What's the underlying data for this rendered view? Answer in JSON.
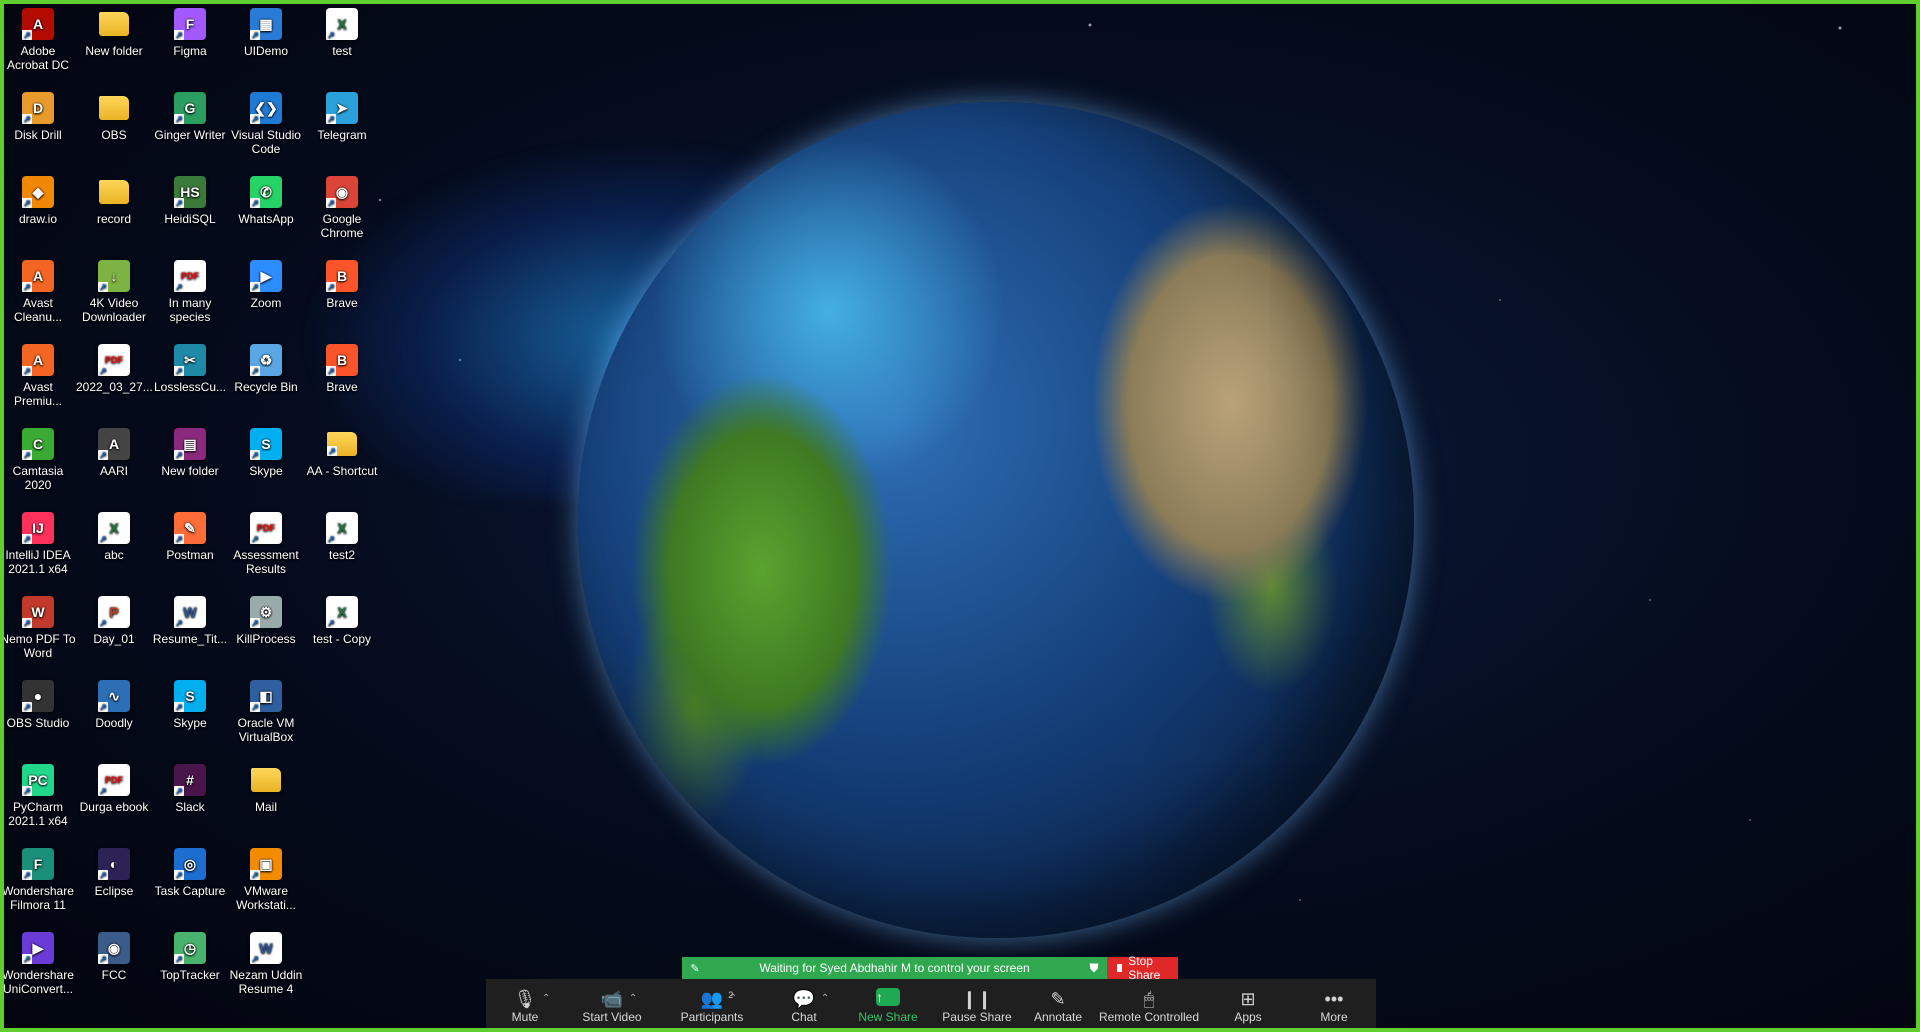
{
  "desktop": {
    "icons": [
      {
        "label": "Adobe Acrobat DC",
        "icon": "acrobat-icon",
        "color": "#b30b00",
        "glyph": "A",
        "kind": "app",
        "col": 0,
        "row": 0
      },
      {
        "label": "New folder",
        "icon": "folder-icon",
        "kind": "folder",
        "col": 1,
        "row": 0
      },
      {
        "label": "Figma",
        "icon": "figma-icon",
        "color": "#a259ff",
        "glyph": "F",
        "kind": "app",
        "col": 2,
        "row": 0
      },
      {
        "label": "UIDemo",
        "icon": "window-icon",
        "color": "#2a7ad8",
        "glyph": "▦",
        "kind": "app",
        "col": 3,
        "row": 0
      },
      {
        "label": "test",
        "icon": "excel-icon",
        "kind": "xls",
        "glyph": "X",
        "col": 4,
        "row": 0
      },
      {
        "label": "Disk Drill",
        "icon": "disk-drill-icon",
        "color": "#e79b2a",
        "glyph": "D",
        "kind": "app",
        "col": 0,
        "row": 1
      },
      {
        "label": "OBS",
        "icon": "folder-icon",
        "kind": "folder",
        "col": 1,
        "row": 1
      },
      {
        "label": "Ginger Writer",
        "icon": "ginger-icon",
        "color": "#2b9d5e",
        "glyph": "G",
        "kind": "app",
        "col": 2,
        "row": 1
      },
      {
        "label": "Visual Studio Code",
        "icon": "vscode-icon",
        "color": "#1f7ad4",
        "glyph": "❮❯",
        "kind": "app",
        "col": 3,
        "row": 1
      },
      {
        "label": "Telegram",
        "icon": "telegram-icon",
        "color": "#2aa1da",
        "glyph": "➤",
        "kind": "app",
        "col": 4,
        "row": 1
      },
      {
        "label": "draw.io",
        "icon": "drawio-icon",
        "color": "#f08705",
        "glyph": "◆",
        "kind": "app",
        "col": 0,
        "row": 2
      },
      {
        "label": "record",
        "icon": "folder-icon",
        "kind": "folder",
        "col": 1,
        "row": 2
      },
      {
        "label": "HeidiSQL",
        "icon": "heidisql-icon",
        "color": "#3a7a3a",
        "glyph": "HS",
        "kind": "app",
        "col": 2,
        "row": 2
      },
      {
        "label": "WhatsApp",
        "icon": "whatsapp-icon",
        "color": "#25d366",
        "glyph": "✆",
        "kind": "app",
        "col": 3,
        "row": 2
      },
      {
        "label": "Google Chrome",
        "icon": "chrome-icon",
        "color": "#db4437",
        "glyph": "◉",
        "kind": "app",
        "col": 4,
        "row": 2
      },
      {
        "label": "Avast Cleanu...",
        "icon": "avast-cleanup-icon",
        "color": "#f26522",
        "glyph": "A",
        "kind": "app",
        "col": 0,
        "row": 3
      },
      {
        "label": "4K Video Downloader",
        "icon": "4k-downloader-icon",
        "color": "#7cb342",
        "glyph": "↓",
        "kind": "app",
        "col": 1,
        "row": 3
      },
      {
        "label": "In many species",
        "icon": "pdf-icon",
        "kind": "pdf",
        "glyph": "PDF",
        "col": 2,
        "row": 3
      },
      {
        "label": "Zoom",
        "icon": "zoom-icon",
        "color": "#2d8cff",
        "glyph": "▶",
        "kind": "app",
        "col": 3,
        "row": 3
      },
      {
        "label": "Brave",
        "icon": "brave-icon",
        "color": "#fb542b",
        "glyph": "B",
        "kind": "app",
        "col": 4,
        "row": 3
      },
      {
        "label": "Avast Premiu...",
        "icon": "avast-icon",
        "color": "#f26522",
        "glyph": "A",
        "kind": "app",
        "col": 0,
        "row": 4
      },
      {
        "label": "2022_03_27...",
        "icon": "pdf-icon",
        "kind": "pdf",
        "glyph": "PDF",
        "col": 1,
        "row": 4
      },
      {
        "label": "LosslessCu...",
        "icon": "lossless-cut-icon",
        "color": "#1e8aa8",
        "glyph": "✂",
        "kind": "app",
        "col": 2,
        "row": 4
      },
      {
        "label": "Recycle Bin",
        "icon": "recycle-bin-icon",
        "color": "#5aa7e6",
        "glyph": "♻",
        "kind": "app",
        "col": 3,
        "row": 4
      },
      {
        "label": "Brave",
        "icon": "brave-icon",
        "color": "#fb542b",
        "glyph": "B",
        "kind": "app",
        "col": 4,
        "row": 4
      },
      {
        "label": "Camtasia 2020",
        "icon": "camtasia-icon",
        "color": "#3aaa35",
        "glyph": "C",
        "kind": "app",
        "col": 0,
        "row": 5
      },
      {
        "label": "AARI",
        "icon": "aari-icon",
        "color": "#444",
        "glyph": "A",
        "kind": "app",
        "col": 1,
        "row": 5
      },
      {
        "label": "New folder",
        "icon": "winrar-icon",
        "color": "#8b2a7c",
        "glyph": "▤",
        "kind": "app",
        "col": 2,
        "row": 5
      },
      {
        "label": "Skype",
        "icon": "skype-icon",
        "color": "#00aff0",
        "glyph": "S",
        "kind": "app",
        "col": 3,
        "row": 5
      },
      {
        "label": "AA - Shortcut",
        "icon": "folder-icon",
        "kind": "folder",
        "col": 4,
        "row": 5
      },
      {
        "label": "IntelliJ IDEA 2021.1 x64",
        "icon": "intellij-icon",
        "color": "#fe315d",
        "glyph": "IJ",
        "kind": "app",
        "col": 0,
        "row": 6
      },
      {
        "label": "abc",
        "icon": "excel-icon",
        "kind": "xls",
        "glyph": "X",
        "col": 1,
        "row": 6
      },
      {
        "label": "Postman",
        "icon": "postman-icon",
        "color": "#ff6c37",
        "glyph": "✎",
        "kind": "app",
        "col": 2,
        "row": 6
      },
      {
        "label": "Assessment Results",
        "icon": "pdf-icon",
        "kind": "pdf",
        "glyph": "PDF",
        "col": 3,
        "row": 6
      },
      {
        "label": "test2",
        "icon": "excel-icon",
        "kind": "xls",
        "glyph": "X",
        "col": 4,
        "row": 6
      },
      {
        "label": "Nemo PDF To Word",
        "icon": "nemo-pdf-icon",
        "color": "#c0392b",
        "glyph": "W",
        "kind": "app",
        "col": 0,
        "row": 7
      },
      {
        "label": "Day_01",
        "icon": "powerpoint-icon",
        "kind": "ppt",
        "glyph": "P",
        "col": 1,
        "row": 7
      },
      {
        "label": "Resume_Tit...",
        "icon": "word-icon",
        "kind": "doc",
        "glyph": "W",
        "col": 2,
        "row": 7
      },
      {
        "label": "KillProcess",
        "icon": "killprocess-icon",
        "color": "#9aa",
        "glyph": "⚙",
        "kind": "app",
        "col": 3,
        "row": 7
      },
      {
        "label": "test - Copy",
        "icon": "excel-icon",
        "kind": "xls",
        "glyph": "X",
        "col": 4,
        "row": 7
      },
      {
        "label": "OBS Studio",
        "icon": "obs-icon",
        "color": "#333",
        "glyph": "●",
        "kind": "app",
        "col": 0,
        "row": 8
      },
      {
        "label": "Doodly",
        "icon": "doodly-icon",
        "color": "#2c6fb7",
        "glyph": "∿",
        "kind": "app",
        "col": 1,
        "row": 8
      },
      {
        "label": "Skype",
        "icon": "skype-icon",
        "color": "#00aff0",
        "glyph": "S",
        "kind": "app",
        "col": 2,
        "row": 8
      },
      {
        "label": "Oracle VM VirtualBox",
        "icon": "virtualbox-icon",
        "color": "#2f5f9e",
        "glyph": "◧",
        "kind": "app",
        "col": 3,
        "row": 8
      },
      {
        "label": "PyCharm 2021.1 x64",
        "icon": "pycharm-icon",
        "color": "#21d789",
        "glyph": "PC",
        "kind": "app",
        "col": 0,
        "row": 9
      },
      {
        "label": "Durga ebook",
        "icon": "pdf-icon",
        "kind": "pdf",
        "glyph": "PDF",
        "col": 1,
        "row": 9
      },
      {
        "label": "Slack",
        "icon": "slack-icon",
        "color": "#4a154b",
        "glyph": "#",
        "kind": "app",
        "col": 2,
        "row": 9
      },
      {
        "label": "Mail",
        "icon": "folder-icon",
        "kind": "folder",
        "col": 3,
        "row": 9
      },
      {
        "label": "Wondershare Filmora 11",
        "icon": "filmora-icon",
        "color": "#1a8f7a",
        "glyph": "F",
        "kind": "app",
        "col": 0,
        "row": 10
      },
      {
        "label": "Eclipse",
        "icon": "eclipse-icon",
        "color": "#2c2255",
        "glyph": "◐",
        "kind": "app",
        "col": 1,
        "row": 10
      },
      {
        "label": "Task Capture",
        "icon": "task-capture-icon",
        "color": "#1c6fd1",
        "glyph": "◎",
        "kind": "app",
        "col": 2,
        "row": 10
      },
      {
        "label": "VMware Workstati...",
        "icon": "vmware-icon",
        "color": "#f38b00",
        "glyph": "▣",
        "kind": "app",
        "col": 3,
        "row": 10
      },
      {
        "label": "Wondershare UniConvert...",
        "icon": "uniconverter-icon",
        "color": "#6a3bd6",
        "glyph": "▶",
        "kind": "app",
        "col": 0,
        "row": 11
      },
      {
        "label": "FCC",
        "icon": "fcc-icon",
        "color": "#3b5b8a",
        "glyph": "◉",
        "kind": "app",
        "col": 1,
        "row": 11
      },
      {
        "label": "TopTracker",
        "icon": "toptracker-icon",
        "color": "#47b36c",
        "glyph": "◷",
        "kind": "app",
        "col": 2,
        "row": 11
      },
      {
        "label": "Nezam Uddin Resume 4",
        "icon": "word-icon",
        "kind": "doc",
        "glyph": "W",
        "col": 3,
        "row": 11
      }
    ]
  },
  "share_banner": {
    "message": "Waiting for Syed Abdhahir M to control your screen",
    "stop_label": "Stop Share",
    "color": "#2fa84f",
    "stop_color": "#e02828"
  },
  "toolbar": {
    "buttons": [
      {
        "name": "mute-button",
        "icon": "microphone-icon",
        "glyph": "🎙",
        "label": "Mute",
        "caret": true,
        "width": 78
      },
      {
        "name": "start-video-button",
        "icon": "video-off-icon",
        "glyph": "📹",
        "label": "Start Video",
        "caret": true,
        "width": 96
      },
      {
        "name": "participants-button",
        "icon": "participants-icon",
        "glyph": "👥",
        "label": "Participants",
        "caret": true,
        "badge": "2",
        "width": 104
      },
      {
        "name": "chat-button",
        "icon": "chat-icon",
        "glyph": "💬",
        "label": "Chat",
        "caret": true,
        "width": 80
      },
      {
        "name": "new-share-button",
        "icon": "share-up-icon",
        "glyph": "↑",
        "label": "New Share",
        "green": true,
        "width": 88
      },
      {
        "name": "pause-share-button",
        "icon": "pause-icon",
        "glyph": "❙❙",
        "label": "Pause Share",
        "width": 90
      },
      {
        "name": "annotate-button",
        "icon": "pen-icon",
        "glyph": "✎",
        "label": "Annotate",
        "width": 72
      },
      {
        "name": "remote-controlled-button",
        "icon": "mouse-icon",
        "glyph": "🖱",
        "label": "Remote Controlled",
        "width": 110
      },
      {
        "name": "apps-button",
        "icon": "apps-icon",
        "glyph": "⊞",
        "label": "Apps",
        "width": 88
      },
      {
        "name": "more-button",
        "icon": "more-icon",
        "glyph": "•••",
        "label": "More",
        "width": 84
      }
    ]
  }
}
